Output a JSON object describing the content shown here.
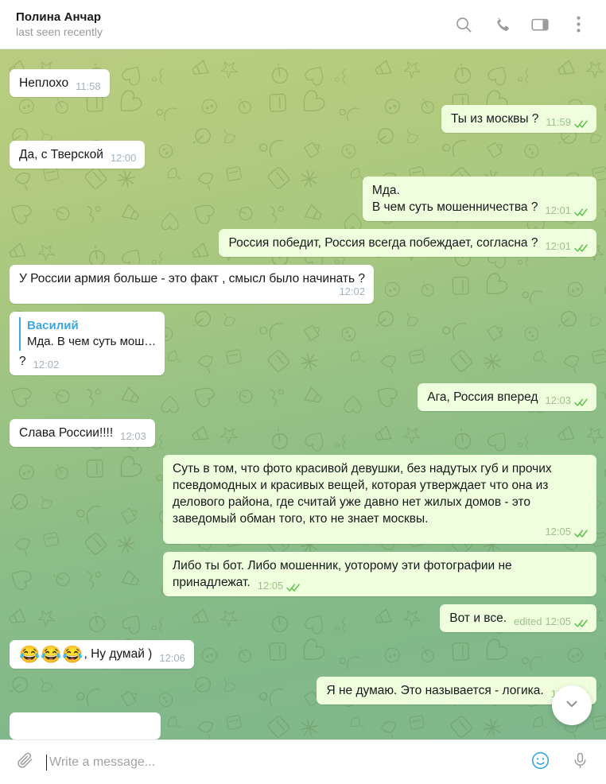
{
  "header": {
    "title": "Полина Анчар",
    "status": "last seen recently",
    "icons": {
      "search": "search-icon",
      "call": "phone-icon",
      "panel": "sidebar-panel-icon",
      "more": "more-vertical-icon"
    }
  },
  "messages": [
    {
      "id": "m0",
      "side": "in",
      "text": "Неплохо",
      "time": "11:58",
      "clipped": true,
      "inline_meta": true
    },
    {
      "id": "m1",
      "side": "out",
      "text": "Ты из москвы ?",
      "time": "11:59",
      "ticks": "double",
      "inline_meta": true
    },
    {
      "id": "m2",
      "side": "in",
      "text": "Да, с Тверской",
      "time": "12:00",
      "inline_meta": true
    },
    {
      "id": "m3",
      "side": "out",
      "text": "Мда.\nВ чем суть мошенничества ?",
      "time": "12:01",
      "ticks": "double",
      "inline_meta": true
    },
    {
      "id": "m4",
      "side": "out",
      "text": "Россия победит, Россия всегда побеждает, согласна ?",
      "time": "12:01",
      "ticks": "double",
      "inline_meta": true
    },
    {
      "id": "m5",
      "side": "in",
      "text": "У России армия больше - это факт , смысл было начинать ?",
      "time": "12:02",
      "inline_meta": false
    },
    {
      "id": "m6",
      "side": "in",
      "text": "?",
      "time": "12:02",
      "inline_meta": true,
      "reply": {
        "name": "Василий",
        "text": "Мда. В чем суть мош…"
      }
    },
    {
      "id": "m7",
      "side": "out",
      "text": "Ага, Россия вперед",
      "time": "12:03",
      "ticks": "double",
      "inline_meta": true
    },
    {
      "id": "m8",
      "side": "in",
      "text": "Слава России!!!!",
      "time": "12:03",
      "inline_meta": true
    },
    {
      "id": "m9",
      "side": "out",
      "text": "Суть в том, что фото красивой девушки, без надутых губ и прочих псевдомодных и красивых вещей, которая утверждает что она из делового района, где считай уже давно нет жилых домов - это заведомый обман того, кто не знает москвы.",
      "time": "12:05",
      "ticks": "double",
      "inline_meta": false
    },
    {
      "id": "m10",
      "side": "out",
      "text": "Либо ты бот. Либо мошенник, уоторому эти фотографии не принадлежат.",
      "time": "12:05",
      "ticks": "double",
      "inline_meta": true
    },
    {
      "id": "m11",
      "side": "out",
      "text": "Вот и все.",
      "time": "12:05",
      "edited": "edited",
      "ticks": "double",
      "inline_meta": true
    },
    {
      "id": "m12",
      "side": "in",
      "emoji": "😂😂😂",
      "text": ", Ну думай )",
      "time": "12:06",
      "inline_meta": true
    },
    {
      "id": "m13",
      "side": "out",
      "text": "Я не думаю. Это называется - логика.",
      "time": "12:0",
      "ticks": "double",
      "inline_meta": true
    }
  ],
  "scroll_button": {
    "icon": "chevron-down-icon"
  },
  "composer": {
    "attach_icon": "paperclip-icon",
    "placeholder": "Write a message...",
    "value": "",
    "emoji_icon": "smiley-icon",
    "voice_icon": "microphone-icon"
  },
  "colors": {
    "bubble_in": "#ffffff",
    "bubble_out": "#effedd",
    "reply_accent": "#3ca7e0",
    "tick_green": "#5dc24e",
    "meta_out": "#9ec08c",
    "meta_in": "#a3b2bd",
    "bg_top": "#b8cc80",
    "bg_bottom": "#7fb78b",
    "emoji_button": "#39a8dd"
  }
}
